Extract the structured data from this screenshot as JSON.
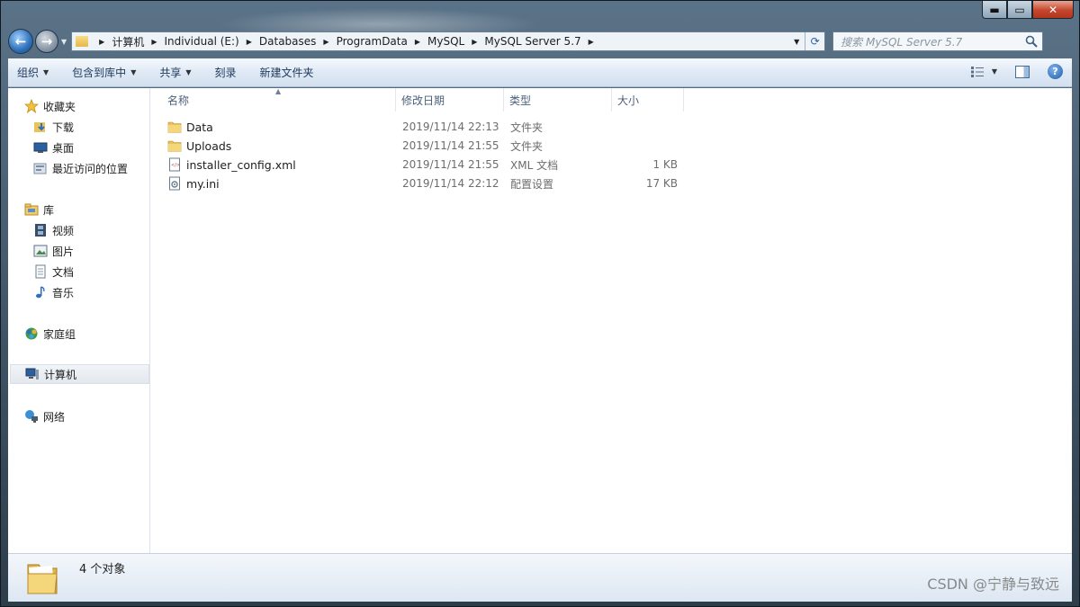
{
  "window": {
    "caption_min": "▬",
    "caption_max": "▭",
    "caption_close": "✕"
  },
  "nav": {
    "back_glyph": "←",
    "forward_glyph": "→",
    "dropdown_glyph": "▼",
    "breadcrumbs": [
      "计算机",
      "Individual (E:)",
      "Databases",
      "ProgramData",
      "MySQL",
      "MySQL Server 5.7"
    ],
    "address_dropdown": "▼",
    "refresh_glyph": "⟳"
  },
  "search": {
    "placeholder": "搜索 MySQL Server 5.7"
  },
  "toolbar": {
    "organize": "组织",
    "include_in_library": "包含到库中",
    "share": "共享",
    "burn": "刻录",
    "new_folder": "新建文件夹",
    "help": "?"
  },
  "navpane": {
    "favorites": "收藏夹",
    "downloads": "下载",
    "desktop": "桌面",
    "recent": "最近访问的位置",
    "libraries": "库",
    "videos": "视频",
    "pictures": "图片",
    "documents": "文档",
    "music": "音乐",
    "homegroup": "家庭组",
    "computer": "计算机",
    "network": "网络"
  },
  "columns": {
    "name": "名称",
    "date": "修改日期",
    "type": "类型",
    "size": "大小"
  },
  "files": [
    {
      "name": "Data",
      "date": "2019/11/14 22:13",
      "type": "文件夹",
      "size": "",
      "icon": "folder-icon"
    },
    {
      "name": "Uploads",
      "date": "2019/11/14 21:55",
      "type": "文件夹",
      "size": "",
      "icon": "folder-icon"
    },
    {
      "name": "installer_config.xml",
      "date": "2019/11/14 21:55",
      "type": "XML 文档",
      "size": "1 KB",
      "icon": "xml-file-icon"
    },
    {
      "name": "my.ini",
      "date": "2019/11/14 22:12",
      "type": "配置设置",
      "size": "17 KB",
      "icon": "ini-file-icon"
    }
  ],
  "details": {
    "count_text": "4 个对象"
  },
  "watermark": "CSDN @宁静与致远",
  "colors": {
    "selection_bg": "#e3e8ee",
    "toolbar_text": "#1e395b",
    "header_text": "#4c607a"
  }
}
